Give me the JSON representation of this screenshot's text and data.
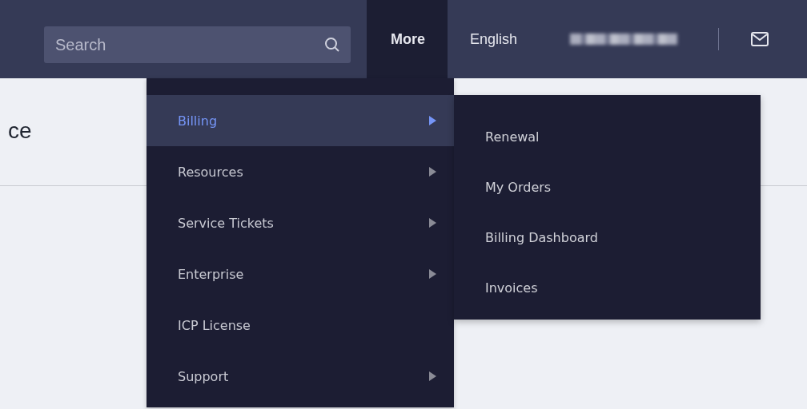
{
  "header": {
    "search": {
      "placeholder": "Search"
    },
    "nav": [
      {
        "label": "More",
        "selected": true
      },
      {
        "label": "English",
        "selected": false
      }
    ]
  },
  "page_title": "ce",
  "menu": [
    {
      "label": "Billing",
      "selected": true,
      "has_submenu": true
    },
    {
      "label": "Resources",
      "selected": false,
      "has_submenu": true
    },
    {
      "label": "Service Tickets",
      "selected": false,
      "has_submenu": true
    },
    {
      "label": "Enterprise",
      "selected": false,
      "has_submenu": true
    },
    {
      "label": "ICP License",
      "selected": false,
      "has_submenu": false
    },
    {
      "label": "Support",
      "selected": false,
      "has_submenu": true
    }
  ],
  "submenu": [
    "Renewal",
    "My Orders",
    "Billing Dashboard",
    "Invoices"
  ]
}
